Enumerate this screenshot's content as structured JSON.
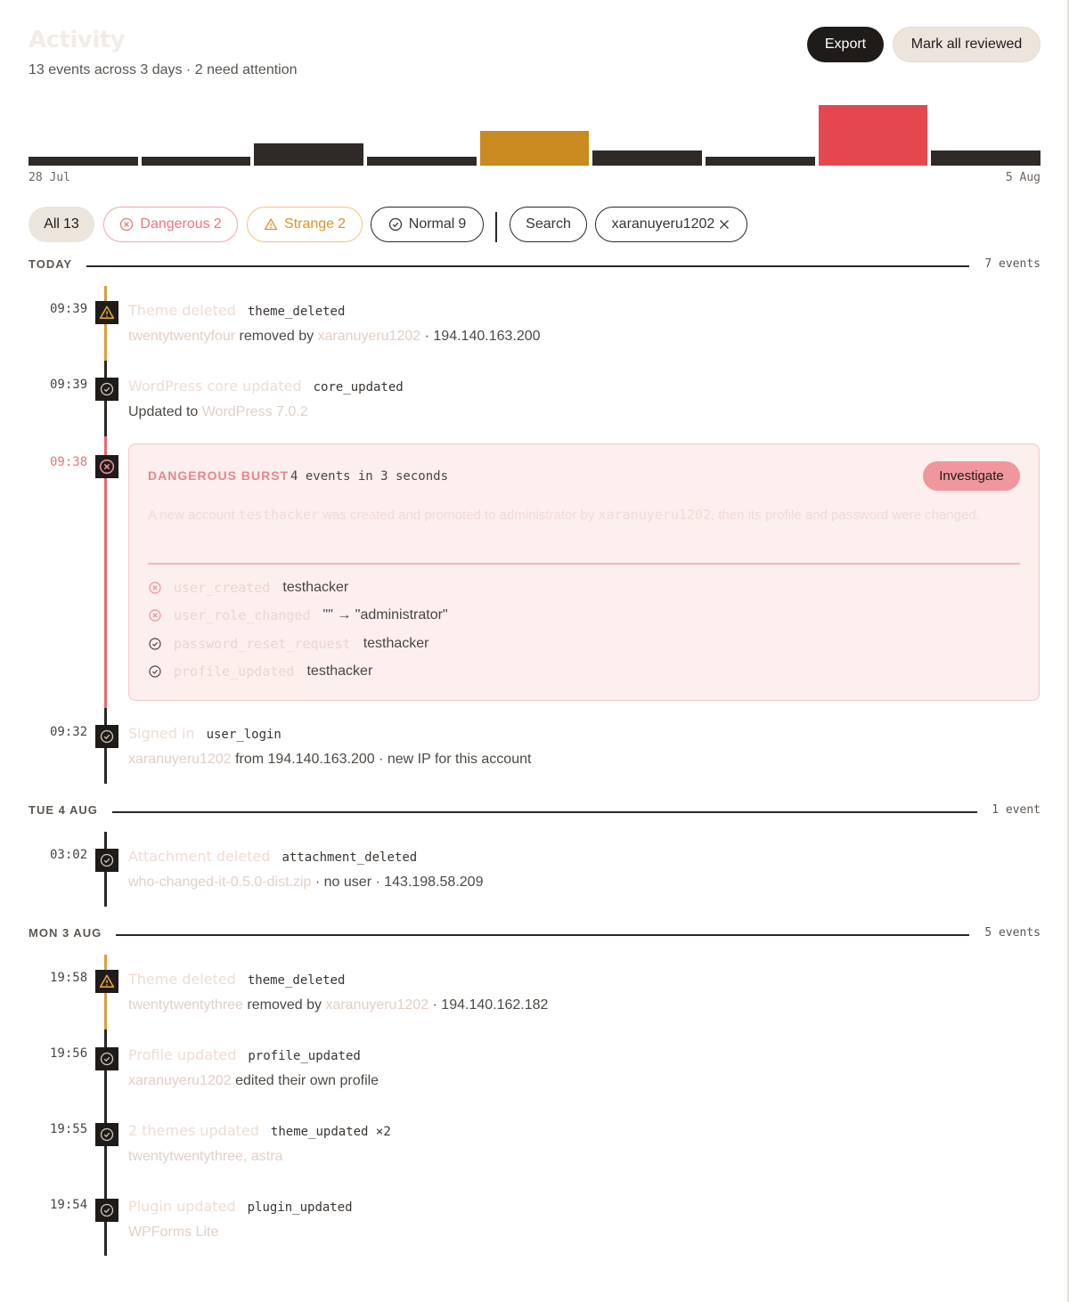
{
  "header": {
    "title": "Activity",
    "subtitle": "13 events across 3 days · 2 need attention",
    "export_label": "Export",
    "mark_all_label": "Mark all reviewed"
  },
  "histogram": {
    "start_label": "28 Jul",
    "end_label": "5 Aug",
    "days": [
      {
        "level": 1,
        "severity": "normal"
      },
      {
        "level": 1,
        "severity": "normal"
      },
      {
        "level": 2,
        "severity": "normal"
      },
      {
        "level": 1,
        "severity": "normal"
      },
      {
        "level": 3,
        "severity": "strange"
      },
      {
        "level": 1.5,
        "severity": "normal"
      },
      {
        "level": 1,
        "severity": "normal"
      },
      {
        "level": 5,
        "severity": "dangerous"
      },
      {
        "level": 1.5,
        "severity": "normal"
      }
    ]
  },
  "filters": {
    "all": {
      "label": "All",
      "count": "13"
    },
    "dangerous": {
      "label": "Dangerous",
      "count": "2"
    },
    "strange": {
      "label": "Strange",
      "count": "2"
    },
    "normal": {
      "label": "Normal",
      "count": "9"
    },
    "search_label": "Search",
    "user_filter": "xaranuyeru1202"
  },
  "days": {
    "today": {
      "label": "TODAY",
      "count": "7 events"
    },
    "tue": {
      "label": "TUE 4 AUG",
      "count": "1 event"
    },
    "mon": {
      "label": "MON 3 AUG",
      "count": "5 events"
    }
  },
  "events": {
    "e1": {
      "time": "09:39",
      "title": "Theme deleted",
      "code": "theme_deleted",
      "d1": "twentytwentyfour",
      "d2": " removed by ",
      "d3": "xaranuyeru1202",
      "d4": " · 194.140.163.200"
    },
    "e2": {
      "time": "09:39",
      "title": "WordPress core updated",
      "code": "core_updated",
      "d1": "Updated to ",
      "d2": "WordPress 7.0.2"
    },
    "e3": {
      "time": "09:38"
    },
    "e4": {
      "time": "09:32",
      "title": "Signed in",
      "code": "user_login",
      "d1": "xaranuyeru1202",
      "d2": " from 194.140.163.200 · new IP for this account"
    },
    "e5": {
      "time": "03:02",
      "title": "Attachment deleted",
      "code": "attachment_deleted",
      "d1": "who-changed-it-0.5.0-dist.zip",
      "d2": " · no user · 143.198.58.209"
    },
    "e6": {
      "time": "19:58",
      "title": "Theme deleted",
      "code": "theme_deleted",
      "d1": "twentytwentythree",
      "d2": " removed by ",
      "d3": "xaranuyeru1202",
      "d4": " · 194.140.162.182"
    },
    "e7": {
      "time": "19:56",
      "title": "Profile updated",
      "code": "profile_updated",
      "d1": "xaranuyeru1202",
      "d2": " edited their own profile"
    },
    "e8": {
      "time": "19:55",
      "title": "2 themes updated",
      "code": "theme_updated ×2",
      "d1": "twentytwentythree, astra"
    },
    "e9": {
      "time": "19:54",
      "title": "Plugin updated",
      "code": "plugin_updated",
      "d1": "WPForms Lite"
    }
  },
  "burst": {
    "label": "DANGEROUS BURST",
    "count_text": "4 events in 3 seconds",
    "investigate_label": "Investigate",
    "desc_1": "A new account ",
    "desc_user": "testhacker",
    "desc_2": " was created and promoted to administrator by ",
    "desc_actor": "xaranuyeru1202",
    "desc_3": ", then its profile and password were changed.",
    "items": [
      {
        "severity": "dangerous",
        "code": "user_created",
        "value": "testhacker"
      },
      {
        "severity": "dangerous",
        "code": "user_role_changed",
        "value": "\"\" → \"administrator\""
      },
      {
        "severity": "normal",
        "code": "password_reset_request",
        "value": "testhacker"
      },
      {
        "severity": "normal",
        "code": "profile_updated",
        "value": "testhacker"
      }
    ]
  },
  "colors": {
    "dark": "#2f2a27",
    "strange": "#c98a1f",
    "dangerous": "#e5474f",
    "accent_bg": "#ece5dc"
  }
}
